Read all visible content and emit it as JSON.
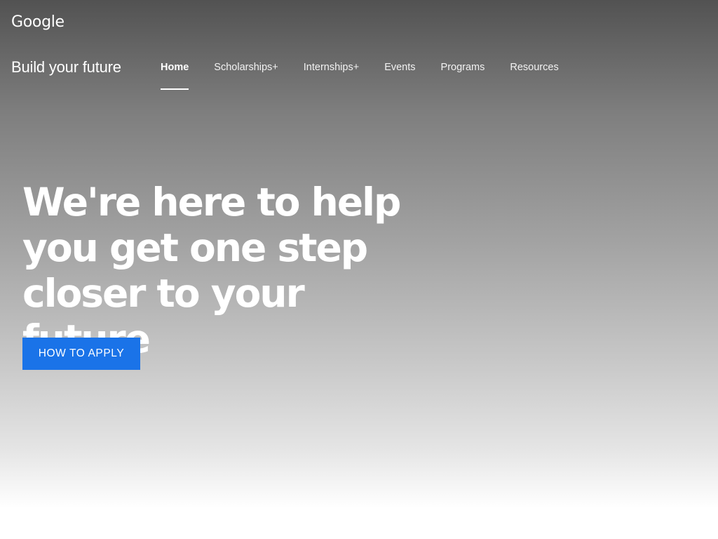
{
  "header": {
    "logo_text": "Google",
    "site_title": "Build your future"
  },
  "nav": {
    "items": [
      {
        "label": "Home",
        "active": true
      },
      {
        "label": "Scholarships+",
        "active": false
      },
      {
        "label": "Internships+",
        "active": false
      },
      {
        "label": "Events",
        "active": false
      },
      {
        "label": "Programs",
        "active": false
      },
      {
        "label": "Resources",
        "active": false
      }
    ]
  },
  "hero": {
    "headline_lines": [
      "We're here to help",
      "you get one step",
      "closer to your future"
    ],
    "cta_label": "HOW TO APPLY"
  },
  "colors": {
    "accent": "#1a73e8",
    "text_on_hero": "#ffffff"
  }
}
